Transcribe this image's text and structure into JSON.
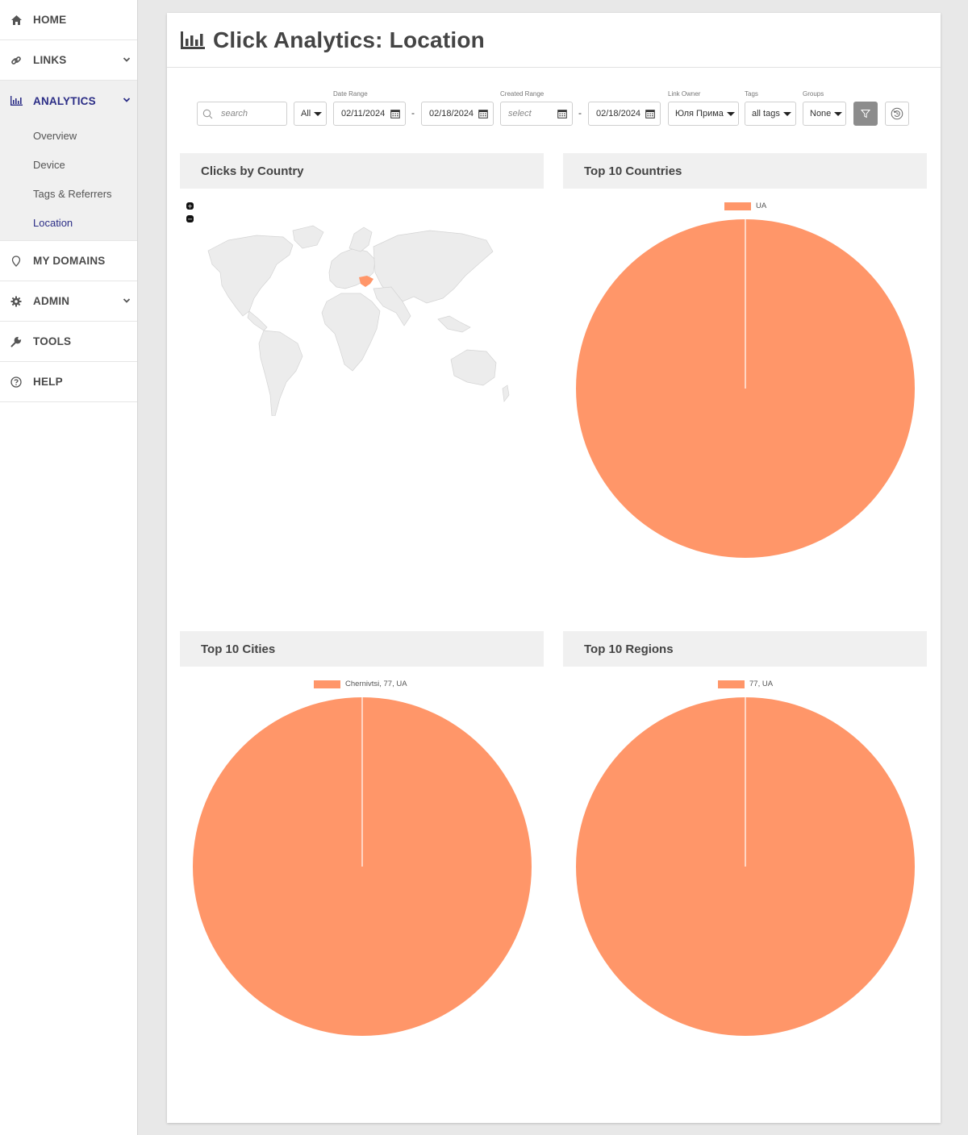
{
  "sidebar": {
    "items": [
      {
        "label": "HOME",
        "icon": "home-icon"
      },
      {
        "label": "LINKS",
        "icon": "link-icon"
      },
      {
        "label": "ANALYTICS",
        "icon": "bar-chart-icon"
      },
      {
        "label": "MY DOMAINS",
        "icon": "map-pin-icon"
      },
      {
        "label": "ADMIN",
        "icon": "gear-icon"
      },
      {
        "label": "TOOLS",
        "icon": "wrench-icon"
      },
      {
        "label": "HELP",
        "icon": "question-circle-icon"
      }
    ],
    "analytics_sub": [
      "Overview",
      "Device",
      "Tags & Referrers",
      "Location"
    ]
  },
  "header": {
    "title": "Click Analytics: Location",
    "icon": "bar-chart-icon"
  },
  "filters": {
    "search_placeholder": "search",
    "type_value": "All",
    "date_range_label": "Date Range",
    "date_from": "02/11/2024",
    "date_to": "02/18/2024",
    "created_range_label": "Created Range",
    "created_from_placeholder": "select",
    "created_to": "02/18/2024",
    "link_owner_label": "Link Owner",
    "link_owner_value": "Юля Прима",
    "tags_label": "Tags",
    "tags_value": "all tags",
    "groups_label": "Groups",
    "groups_value": "None",
    "filter_icon": "filter-icon",
    "reset_icon": "reset-icon"
  },
  "colors": {
    "accent": "#2b2d86",
    "slice": "#ff9669",
    "highlight_country": "#ff9669",
    "map_land": "#ececec"
  },
  "panels": {
    "map": {
      "title": "Clicks by Country",
      "highlighted": "UA",
      "zoom_in": "+",
      "zoom_out": "−"
    },
    "countries": {
      "title": "Top 10 Countries"
    },
    "cities": {
      "title": "Top 10 Cities"
    },
    "regions": {
      "title": "Top 10 Regions"
    }
  },
  "chart_data": [
    {
      "type": "pie",
      "title": "Top 10 Countries",
      "labels": [
        "UA"
      ],
      "values": [
        1
      ]
    },
    {
      "type": "pie",
      "title": "Top 10 Cities",
      "labels": [
        "Chernivtsi, 77, UA"
      ],
      "values": [
        1
      ]
    },
    {
      "type": "pie",
      "title": "Top 10 Regions",
      "labels": [
        "77, UA"
      ],
      "values": [
        1
      ]
    }
  ]
}
